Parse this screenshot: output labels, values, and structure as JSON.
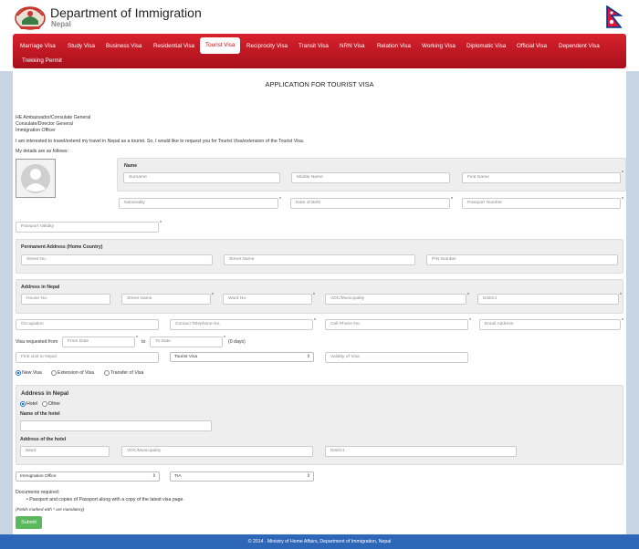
{
  "header": {
    "title": "Department of Immigration",
    "subtitle": "Nepal"
  },
  "nav": {
    "items": [
      {
        "label": "Marriage Visa"
      },
      {
        "label": "Study Visa"
      },
      {
        "label": "Business Visa"
      },
      {
        "label": "Residential Visa"
      },
      {
        "label": "Tourist Visa"
      },
      {
        "label": "Reciprocity Visa"
      },
      {
        "label": "Transit Visa"
      },
      {
        "label": "NRN Visa"
      },
      {
        "label": "Relation Visa"
      },
      {
        "label": "Working Visa"
      },
      {
        "label": "Diplomatic Visa"
      },
      {
        "label": "Official Visa"
      },
      {
        "label": "Dependent Visa"
      },
      {
        "label": "Trekking Permit"
      }
    ],
    "active_index": 4
  },
  "form": {
    "title": "APPLICATION FOR TOURIST VISA",
    "recipient": [
      "HE Ambassador/Consulate General",
      "Consulate/Director General",
      "Immigration Officer"
    ],
    "intro": "I am interested to travel/extend my travel in Nepal as a tourist. So, I would like to request you for Tourist Visa/extension of the Tourist Visa.",
    "details_label": "My details are as follows:",
    "name_section": "Name",
    "surname": "Surname",
    "middle_name": "Middle Name",
    "first_name": "First Name",
    "nationality": "Nationality",
    "dob": "Date of Birth",
    "passport_number": "Passport Number",
    "passport_validity": "Passport Validity",
    "perm_address": {
      "title": "Permanent Address (Home Country)",
      "street_no": "Street No.",
      "street_name": "Street Name",
      "pin": "PIN Number"
    },
    "nepal_address": {
      "title": "Address in Nepal",
      "house_no": "House No.",
      "street_name": "Street Name",
      "ward_no": "Ward No.",
      "vdc": "VDC/Municipality",
      "district": "District"
    },
    "occupation": "Occupation",
    "contact_tel": "Contact Telephone No.",
    "cell_phone": "Cell Phone No.",
    "email": "Email Address",
    "visa_requested_from": "Visa requested from",
    "from_date": "From Date",
    "to": "to",
    "to_date": "To Date",
    "days": "(0 days)",
    "first_visit": "First visit to Nepal",
    "visa_type_selected": "Tourist Visa",
    "validity_of_visa": "Validity of Visa",
    "visa_options": [
      {
        "label": "New Visa",
        "selected": true
      },
      {
        "label": "Extension of Visa",
        "selected": false
      },
      {
        "label": "Transfer of Visa",
        "selected": false
      }
    ],
    "stay": {
      "title": "Address in Nepal",
      "hotel": "Hotel",
      "other": "Other",
      "hotel_selected": true,
      "hotel_name_label": "Name of the hotel",
      "hotel_address_label": "Address of the hotel",
      "ward": "Ward",
      "vdc": "VDC/Municipality",
      "district": "District"
    },
    "office_selected": "Immigration Office",
    "location_selected": "TIA",
    "documents_label": "Documents required:",
    "documents": [
      "Passport and copies of Passport along with a copy of the latest visa page."
    ],
    "mandatory_note": "(Fields marked with * are mandatory)",
    "submit": "Submit",
    "required_mark": "*"
  },
  "footer": {
    "text": "© 2014 . Ministry of Home Affairs, Department of Immigration, Nepal"
  },
  "colors": {
    "nav": "#c0121c",
    "footer": "#2e66b8",
    "submit": "#5cb85c",
    "side": "#c7d4e3"
  },
  "icons": [
    "nepal-emblem-icon",
    "nepal-flag-icon",
    "avatar-placeholder-icon",
    "dropdown-arrow-icon"
  ]
}
